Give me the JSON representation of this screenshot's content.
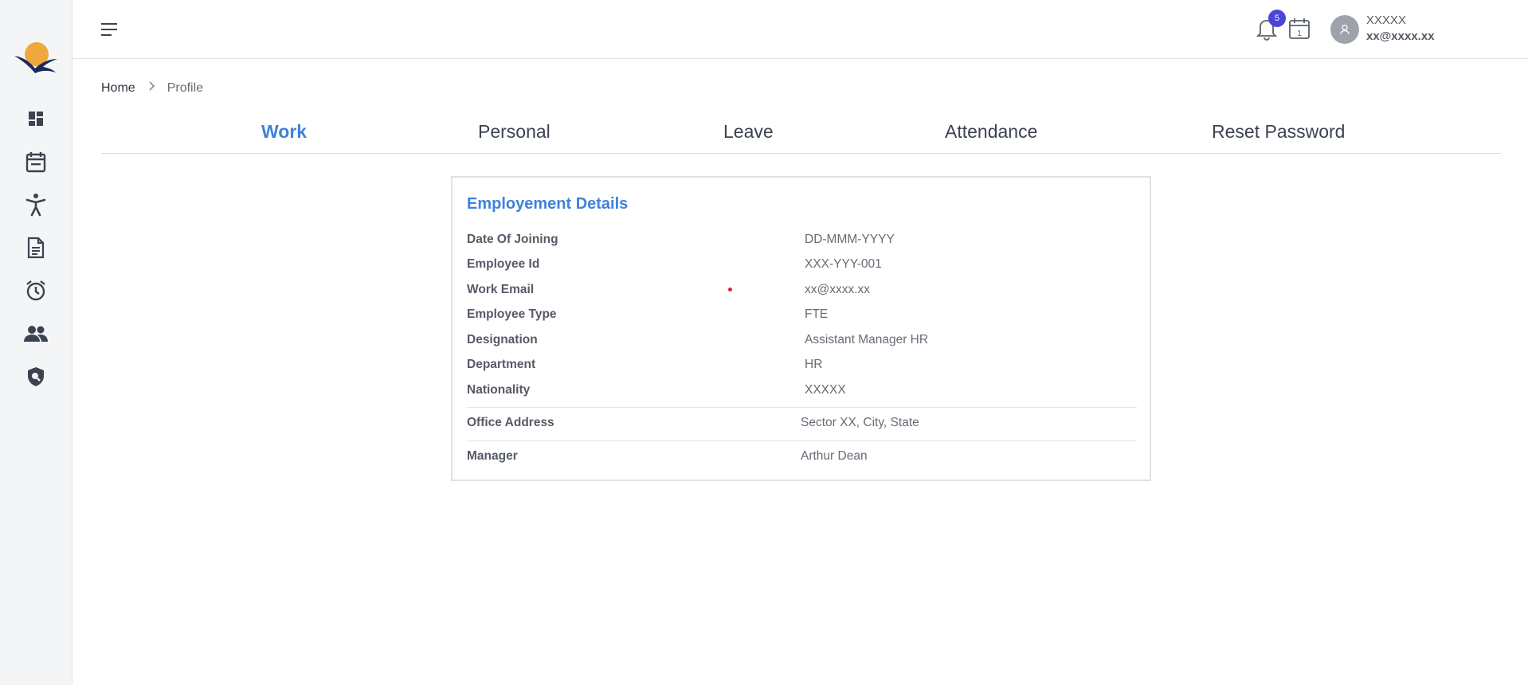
{
  "header": {
    "notification_count": "5",
    "calendar_day": "1",
    "user_name": "XXXXX",
    "user_email": "xx@xxxx.xx"
  },
  "sidebar": {
    "icons": [
      "dashboard-icon",
      "calendar-icon",
      "accessibility-icon",
      "document-icon",
      "alarm-icon",
      "people-icon",
      "shield-search-icon"
    ]
  },
  "breadcrumb": {
    "home": "Home",
    "current": "Profile"
  },
  "tabs": [
    {
      "label": "Work",
      "active": true
    },
    {
      "label": "Personal",
      "active": false
    },
    {
      "label": "Leave",
      "active": false
    },
    {
      "label": "Attendance",
      "active": false
    },
    {
      "label": "Reset Password",
      "active": false
    }
  ],
  "card": {
    "title": "Employement Details",
    "rows": [
      {
        "label": "Date Of Joining",
        "value": "DD-MMM-YYYY"
      },
      {
        "label": "Employee Id",
        "value": "XXX-YYY-001"
      },
      {
        "label": "Work Email",
        "value": "xx@xxxx.xx"
      },
      {
        "label": "Employee Type",
        "value": "FTE"
      },
      {
        "label": "Designation",
        "value": "Assistant Manager HR"
      },
      {
        "label": "Department",
        "value": "HR"
      },
      {
        "label": "Nationality",
        "value": "XXXXX"
      },
      {
        "label": "Office Address",
        "value": "Sector XX, City, State"
      },
      {
        "label": "Manager",
        "value": "Arthur Dean"
      }
    ]
  },
  "colors": {
    "accent": "#3f82d9",
    "badge": "#4a45d8",
    "sidebar_bg": "#f4f5f7",
    "logo_sun": "#f0a83c",
    "logo_bird": "#1b2a5a",
    "required_dot": "#e0203a"
  }
}
